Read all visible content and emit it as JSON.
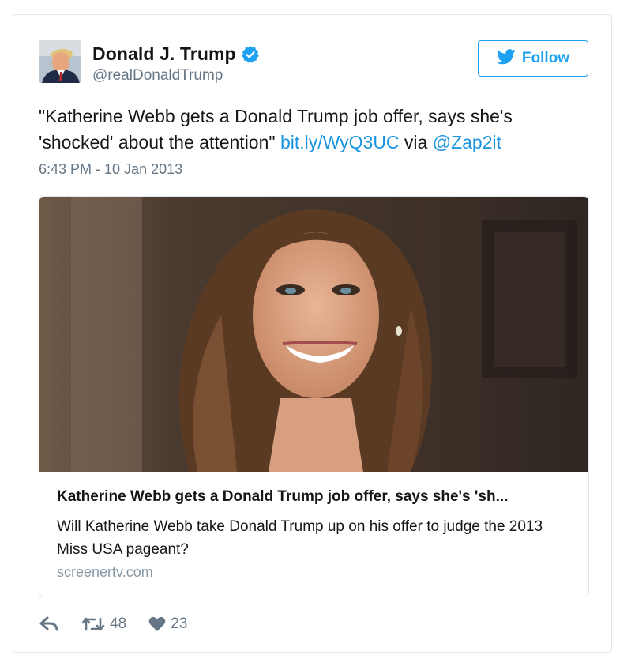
{
  "user": {
    "display_name": "Donald J. Trump",
    "handle": "@realDonaldTrump",
    "verified_icon": "verified-badge-icon",
    "avatar": "profile photo"
  },
  "follow_button": {
    "label": "Follow",
    "icon": "twitter-bird-icon"
  },
  "tweet": {
    "text": "\"Katherine Webb gets a Donald Trump job offer, says she's 'shocked' about the attention\" ",
    "link": "bit.ly/WyQ3UC",
    "via": " via ",
    "mention": "@Zap2it",
    "timestamp": "6:43 PM - 10 Jan 2013"
  },
  "card": {
    "image": "photo of smiling woman with long brown hair",
    "title": "Katherine Webb gets a Donald Trump job offer, says she's 'sh...",
    "description": "Will Katherine Webb take Donald Trump up on his offer to judge the 2013 Miss USA pageant?",
    "domain": "screenertv.com"
  },
  "actions": {
    "reply_icon": "reply-icon",
    "retweet_icon": "retweet-icon",
    "retweet_count": "48",
    "like_icon": "heart-icon",
    "like_count": "23"
  },
  "colors": {
    "accent": "#1da1f2",
    "link": "#1b95e0",
    "secondary_text": "#657786",
    "border": "#e1e8ed"
  }
}
